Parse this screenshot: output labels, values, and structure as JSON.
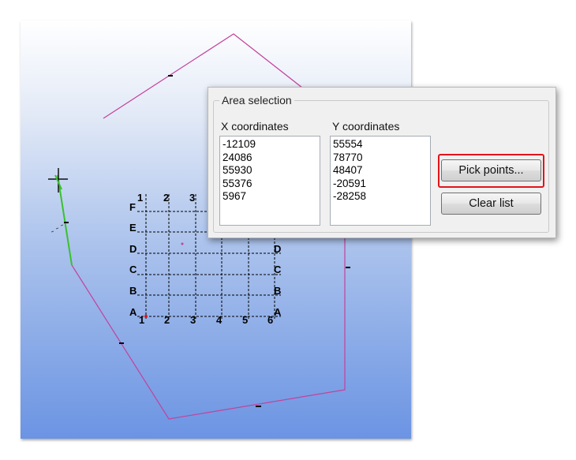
{
  "area_selection": {
    "title": "Area selection",
    "x_header": "X coordinates",
    "y_header": "Y coordinates",
    "x_values": [
      "-12109",
      "24086",
      "55930",
      "55376",
      "5967"
    ],
    "y_values": [
      "55554",
      "78770",
      "48407",
      "-20591",
      "-28258"
    ],
    "pick_points_label": "Pick points...",
    "clear_list_label": "Clear list",
    "highlight_color": "#e1141b"
  },
  "grid": {
    "columns": [
      "1",
      "2",
      "3",
      "4",
      "5",
      "6"
    ],
    "rows": [
      "A",
      "B",
      "C",
      "D",
      "E",
      "F"
    ]
  },
  "colors": {
    "polygon_line": "#c4419a",
    "picked_segment": "#39c12c",
    "grid_line": "#000000"
  }
}
